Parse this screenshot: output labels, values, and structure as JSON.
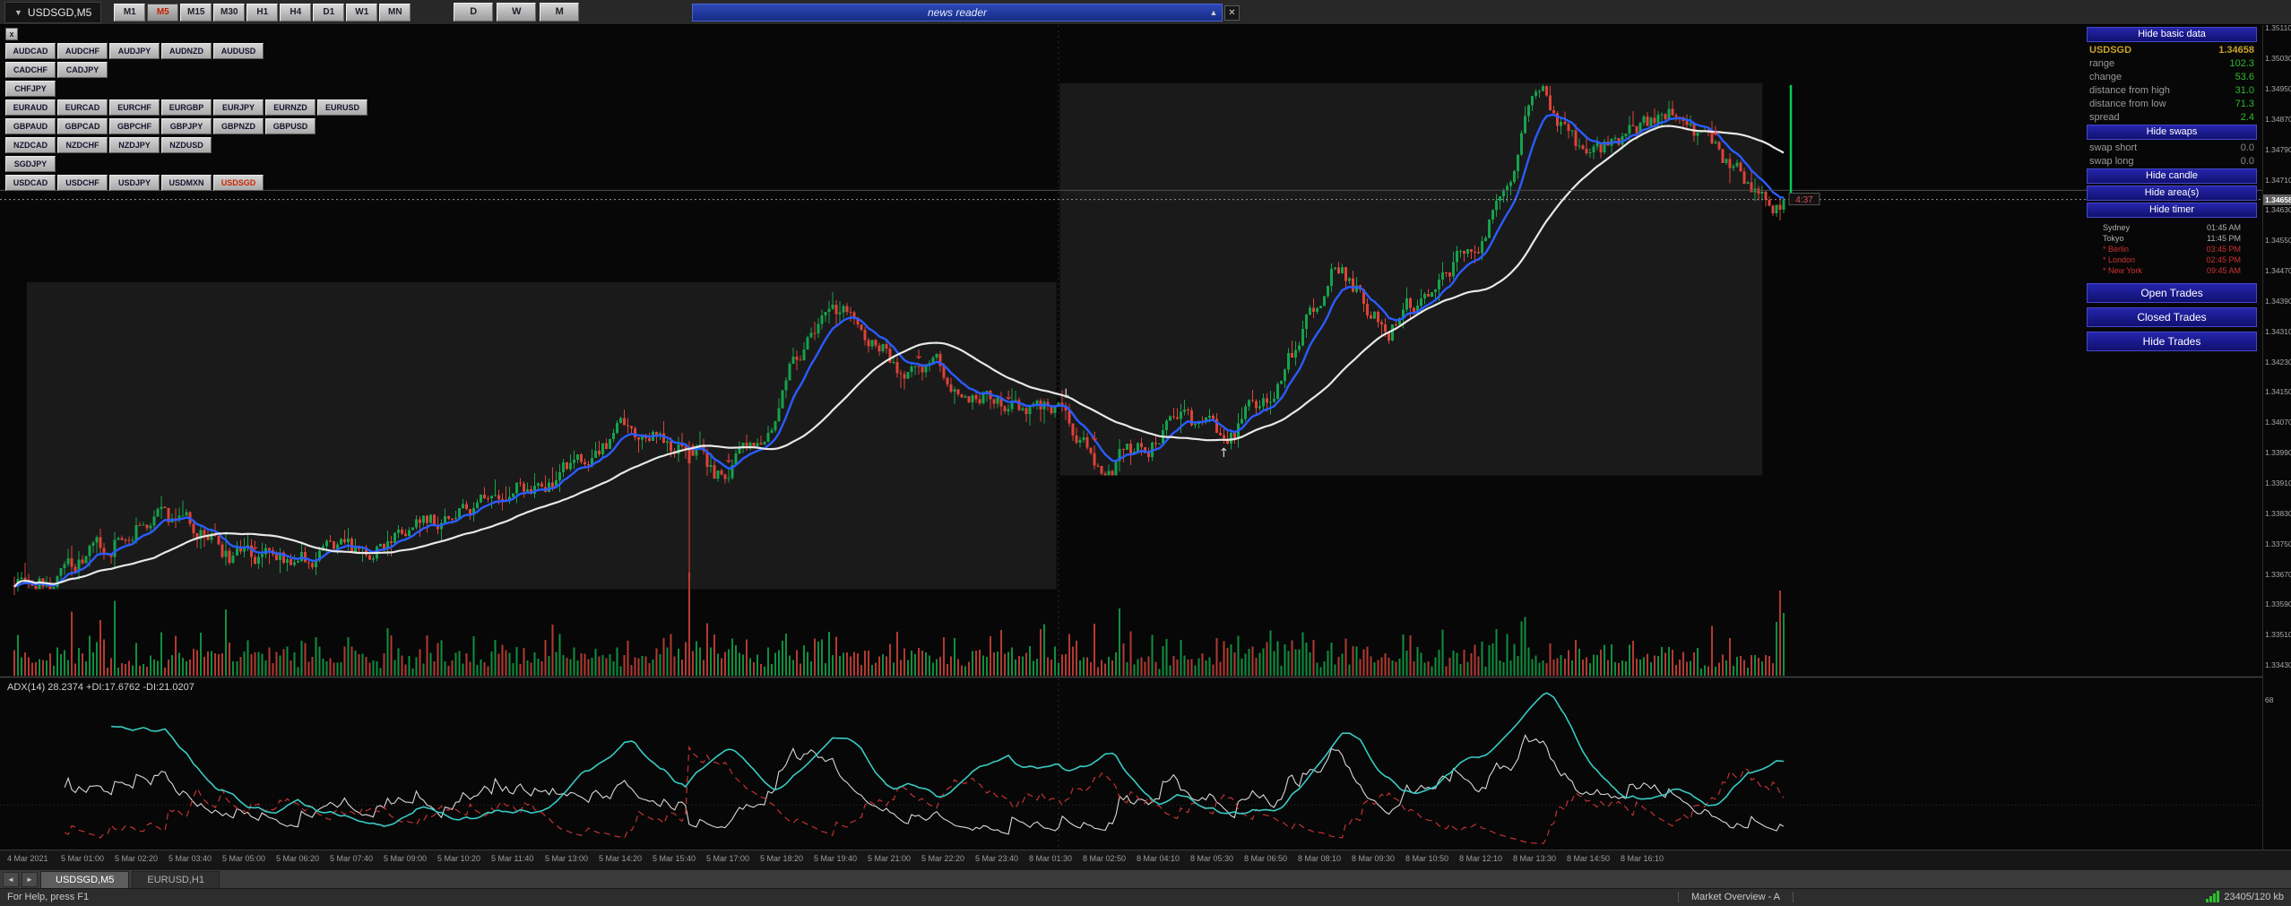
{
  "window": {
    "title": "USDSGD,M5",
    "dropdown_icon": "▼"
  },
  "toolbar": {
    "timeframes": [
      "M1",
      "M5",
      "M15",
      "M30",
      "H1",
      "H4",
      "D1",
      "W1",
      "MN"
    ],
    "active_timeframe": "M5",
    "period_buttons": [
      "D",
      "W",
      "M"
    ],
    "news_reader": {
      "label": "news reader",
      "collapse_icon": "▲",
      "close_icon": "✕"
    }
  },
  "symbol_panel": {
    "close_label": "x",
    "active_symbol": "USDSGD",
    "rows": [
      [
        "AUDCAD",
        "AUDCHF",
        "AUDJPY",
        "AUDNZD",
        "AUDUSD"
      ],
      [
        "CADCHF",
        "CADJPY"
      ],
      [
        "CHFJPY"
      ],
      [
        "EURAUD",
        "EURCAD",
        "EURCHF",
        "EURGBP",
        "EURJPY",
        "EURNZD",
        "EURUSD"
      ],
      [
        "GBPAUD",
        "GBPCAD",
        "GBPCHF",
        "GBPJPY",
        "GBPNZD",
        "GBPUSD"
      ],
      [
        "NZDCAD",
        "NZDCHF",
        "NZDJPY",
        "NZDUSD"
      ],
      [
        "SGDJPY"
      ],
      [
        "USDCAD",
        "USDCHF",
        "USDJPY",
        "USDMXN",
        "USDSGD"
      ]
    ]
  },
  "info_panel": {
    "sections": [
      {
        "type": "button",
        "name": "hide-basic-data",
        "label": "Hide basic data"
      },
      {
        "type": "kv",
        "name": "symbol",
        "label": "USDSGD",
        "value": "1.34658",
        "label_color": "#c9a227",
        "value_color": "#c9a227",
        "bold": true
      },
      {
        "type": "kv",
        "name": "range",
        "label": "range",
        "value": "102.3"
      },
      {
        "type": "kv",
        "name": "change",
        "label": "change",
        "value": "53.6"
      },
      {
        "type": "kv",
        "name": "distance-from-high",
        "label": "distance from high",
        "value": "31.0"
      },
      {
        "type": "kv",
        "name": "distance-from-low",
        "label": "distance from low",
        "value": "71.3"
      },
      {
        "type": "kv",
        "name": "spread",
        "label": "spread",
        "value": "2.4"
      },
      {
        "type": "button",
        "name": "hide-swaps",
        "label": "Hide swaps"
      },
      {
        "type": "kv",
        "name": "swap-short",
        "label": "swap short",
        "value": "0.0",
        "value_color": "#8a8a8a"
      },
      {
        "type": "kv",
        "name": "swap-long",
        "label": "swap long",
        "value": "0.0",
        "value_color": "#8a8a8a"
      },
      {
        "type": "button",
        "name": "hide-candle",
        "label": "Hide candle"
      },
      {
        "type": "button",
        "name": "hide-areas",
        "label": "Hide area(s)"
      },
      {
        "type": "button",
        "name": "hide-timer",
        "label": "Hide timer"
      },
      {
        "type": "sessions",
        "rows": [
          {
            "name": "Sydney",
            "time": "01:45 AM",
            "color": "#b0b0b0"
          },
          {
            "name": "Tokyo",
            "time": "11:45 PM",
            "color": "#b0b0b0"
          },
          {
            "name": "* Berlin",
            "time": "03:45 PM",
            "color": "#d03030"
          },
          {
            "name": "* London",
            "time": "02:45 PM",
            "color": "#d03030"
          },
          {
            "name": "* New York",
            "time": "09:45 AM",
            "color": "#d03030"
          }
        ]
      },
      {
        "type": "button",
        "name": "open-trades",
        "label": "Open Trades",
        "big": true
      },
      {
        "type": "button",
        "name": "closed-trades",
        "label": "Closed Trades",
        "big": true
      },
      {
        "type": "button",
        "name": "hide-trades",
        "label": "Hide Trades",
        "big": true
      }
    ]
  },
  "price_axis": {
    "current": "1.34658",
    "labels": [
      "1.35110",
      "1.35030",
      "1.34950",
      "1.34870",
      "1.34790",
      "1.34710",
      "1.34630",
      "1.34550",
      "1.34470",
      "1.34390",
      "1.34310",
      "1.34230",
      "1.34150",
      "1.34070",
      "1.33990",
      "1.33910",
      "1.33830",
      "1.33750",
      "1.33670",
      "1.33590",
      "1.33510",
      "1.33430"
    ]
  },
  "time_axis": {
    "labels": [
      "4 Mar 2021",
      "5 Mar 01:00",
      "5 Mar 02:20",
      "5 Mar 03:40",
      "5 Mar 05:00",
      "5 Mar 06:20",
      "5 Mar 07:40",
      "5 Mar 09:00",
      "5 Mar 10:20",
      "5 Mar 11:40",
      "5 Mar 13:00",
      "5 Mar 14:20",
      "5 Mar 15:40",
      "5 Mar 17:00",
      "5 Mar 18:20",
      "5 Mar 19:40",
      "5 Mar 21:00",
      "5 Mar 22:20",
      "5 Mar 23:40",
      "8 Mar 01:30",
      "8 Mar 02:50",
      "8 Mar 04:10",
      "8 Mar 05:30",
      "8 Mar 06:50",
      "8 Mar 08:10",
      "8 Mar 09:30",
      "8 Mar 10:50",
      "8 Mar 12:10",
      "8 Mar 13:30",
      "8 Mar 14:50",
      "8 Mar 16:10"
    ]
  },
  "tabs": {
    "scroll_left": "◄",
    "scroll_right": "►",
    "items": [
      {
        "label": "USDSGD,M5",
        "active": true
      },
      {
        "label": "EURUSD,H1",
        "active": false
      }
    ]
  },
  "status_bar": {
    "help": "For Help, press F1",
    "overview": "Market Overview - A",
    "traffic": "23405/120 kb"
  },
  "chart_data": {
    "type": "candlestick",
    "symbol": "USDSGD",
    "timeframe": "M5",
    "bars": 494,
    "seed": 20210308,
    "last_price": 1.34658,
    "price_line": 1.34658,
    "secondary_line": 1.34682,
    "timer_label": "4:37",
    "spike": {
      "f": 0.381,
      "low": 1.33655
    },
    "high_marker": {
      "from": 1.3466,
      "to": 1.3496
    },
    "anchors": [
      [
        0.0,
        1.3364
      ],
      [
        0.04,
        1.337
      ],
      [
        0.071,
        1.3382
      ],
      [
        0.1,
        1.3379
      ],
      [
        0.125,
        1.3371
      ],
      [
        0.16,
        1.337
      ],
      [
        0.192,
        1.3372
      ],
      [
        0.23,
        1.3378
      ],
      [
        0.284,
        1.3391
      ],
      [
        0.32,
        1.3396
      ],
      [
        0.342,
        1.3404
      ],
      [
        0.36,
        1.3403
      ],
      [
        0.381,
        1.34
      ],
      [
        0.401,
        1.3392
      ],
      [
        0.425,
        1.3405
      ],
      [
        0.459,
        1.3441
      ],
      [
        0.475,
        1.3435
      ],
      [
        0.501,
        1.3422
      ],
      [
        0.531,
        1.3418
      ],
      [
        0.56,
        1.3415
      ],
      [
        0.59,
        1.341
      ],
      [
        0.613,
        1.3394
      ],
      [
        0.64,
        1.3402
      ],
      [
        0.659,
        1.3407
      ],
      [
        0.684,
        1.3403
      ],
      [
        0.71,
        1.3415
      ],
      [
        0.747,
        1.3448
      ],
      [
        0.776,
        1.3432
      ],
      [
        0.806,
        1.3445
      ],
      [
        0.83,
        1.3455
      ],
      [
        0.863,
        1.3496
      ],
      [
        0.885,
        1.3476
      ],
      [
        0.91,
        1.3482
      ],
      [
        0.935,
        1.349
      ],
      [
        0.962,
        1.3479
      ],
      [
        0.99,
        1.3466
      ],
      [
        1.0,
        1.34658
      ]
    ],
    "day_boxes": [
      {
        "f1": 0.007,
        "f2": 0.589,
        "high": 1.3444,
        "low": 1.3363
      },
      {
        "f1": 0.591,
        "f2": 0.988,
        "high": 1.34965,
        "low": 1.3393
      }
    ],
    "arrows": [
      {
        "f": 0.135,
        "dir": "down",
        "color": "#e03838"
      },
      {
        "f": 0.403,
        "dir": "down",
        "color": "#e03838"
      },
      {
        "f": 0.512,
        "dir": "down",
        "color": "#e03838"
      },
      {
        "f": 0.561,
        "dir": "down",
        "color": "#e03838"
      },
      {
        "f": 0.594,
        "dir": "down",
        "color": "#d8d8d8"
      },
      {
        "f": 0.61,
        "dir": "down",
        "color": "#e03838"
      },
      {
        "f": 0.684,
        "dir": "up",
        "color": "#d8d8d8"
      },
      {
        "f": 0.961,
        "dir": "down",
        "color": "#e03838"
      }
    ],
    "ma": [
      {
        "name": "fast",
        "color": "#2a5cff",
        "period": 10
      },
      {
        "name": "slow",
        "color": "#e8e8e8",
        "period": 40
      }
    ],
    "colors": {
      "up": "#15a24c",
      "down": "#dd4337",
      "box": "#1a1a1a"
    },
    "indicator": {
      "name": "ADX",
      "period": 14,
      "label": "ADX(14) 28.2374 +DI:17.6762 -DI:21.0207",
      "axis_max_label": "68",
      "levels": [
        20
      ],
      "colors": {
        "adx": "#38cbc4",
        "pdi": "#d8d8d8",
        "mdi": "#c23232"
      }
    }
  }
}
